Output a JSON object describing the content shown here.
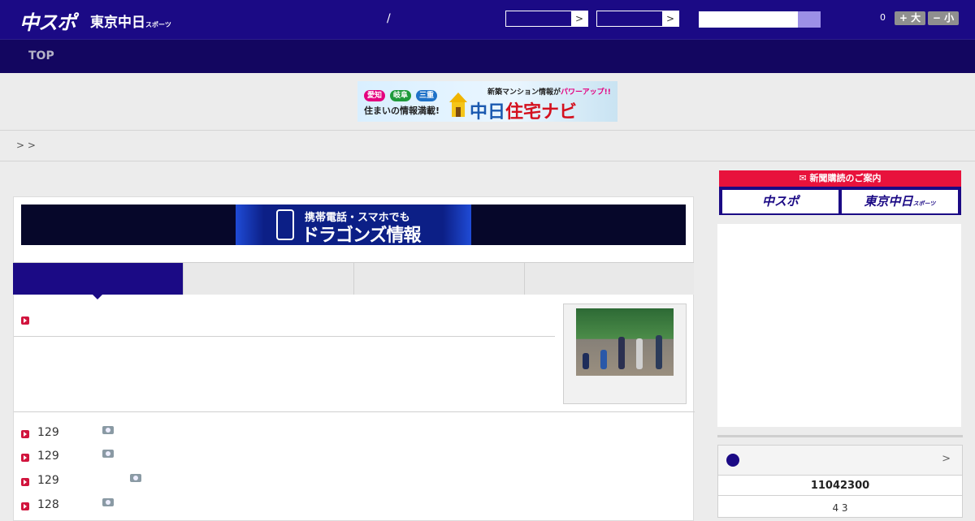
{
  "header": {
    "logo_main": "中スポ",
    "logo_tokyo": "東京中日",
    "logo_tokyo_small": "スポーツ",
    "separator": "/",
    "select_arrow": ">",
    "zoom_value": "0",
    "zoom_in_label": "+ 大",
    "zoom_out_label": "− 小"
  },
  "nav": {
    "top_label": "TOP"
  },
  "housing_banner": {
    "pill_1": "愛知",
    "pill_2": "岐阜",
    "pill_3": "三重",
    "tagline": "住まいの情報満載!",
    "headline_prefix": "新築マンション情報が",
    "headline_highlight": "パワーアップ!!",
    "brand_a": "中日",
    "brand_b": "住宅ナビ"
  },
  "breadcrumb": {
    "text": ">  >"
  },
  "mobile_banner": {
    "line1": "携帯電話・スマホでも",
    "line2": "ドラゴンズ情報"
  },
  "list": {
    "items": [
      {
        "num": "129"
      },
      {
        "num": "129"
      },
      {
        "num": "129"
      },
      {
        "num": "128"
      }
    ]
  },
  "sidebar": {
    "subscription_head": "新聞購読のご案内",
    "sub_btn_1": "中スポ",
    "sub_btn_2": "東京中日",
    "sub_btn_2_small": "スポーツ",
    "score_chevron": ">",
    "score_value": "11042300",
    "score_sub": "4  3"
  }
}
